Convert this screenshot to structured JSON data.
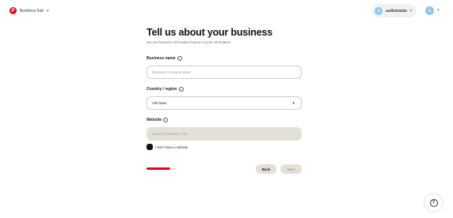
{
  "header": {
    "logo_glyph": "P",
    "hub_label": "Business hub",
    "hub_chevron": "▾",
    "account": {
      "avatar_letter": "a",
      "name": "asdf4343434",
      "chevron": "▾"
    },
    "profile_avatar_letter": "a",
    "profile_chevron": "▾"
  },
  "form": {
    "title": "Tell us about your business",
    "subtitle": "We use business information based on your information",
    "business_name": {
      "label": "Business name",
      "info_glyph": "i",
      "placeholder": "Business or brand name",
      "value": ""
    },
    "country": {
      "label": "Country / region",
      "info_glyph": "i",
      "selected": "Viet Nam",
      "chevron": "▾"
    },
    "website": {
      "label": "Website",
      "info_glyph": "i",
      "placeholder": "www.yourwebsite.com",
      "value": ""
    },
    "no_website_checkbox": {
      "label": "I don't have a website",
      "checked": true
    },
    "progress": {
      "fraction": 1.0
    },
    "back_label": "Back",
    "next_label": "Next"
  },
  "help": {
    "glyph": "?"
  },
  "colors": {
    "brand_red": "#e60023",
    "disabled_fill": "#e3e1d6",
    "avatar_blue": "#8ec8e8"
  }
}
